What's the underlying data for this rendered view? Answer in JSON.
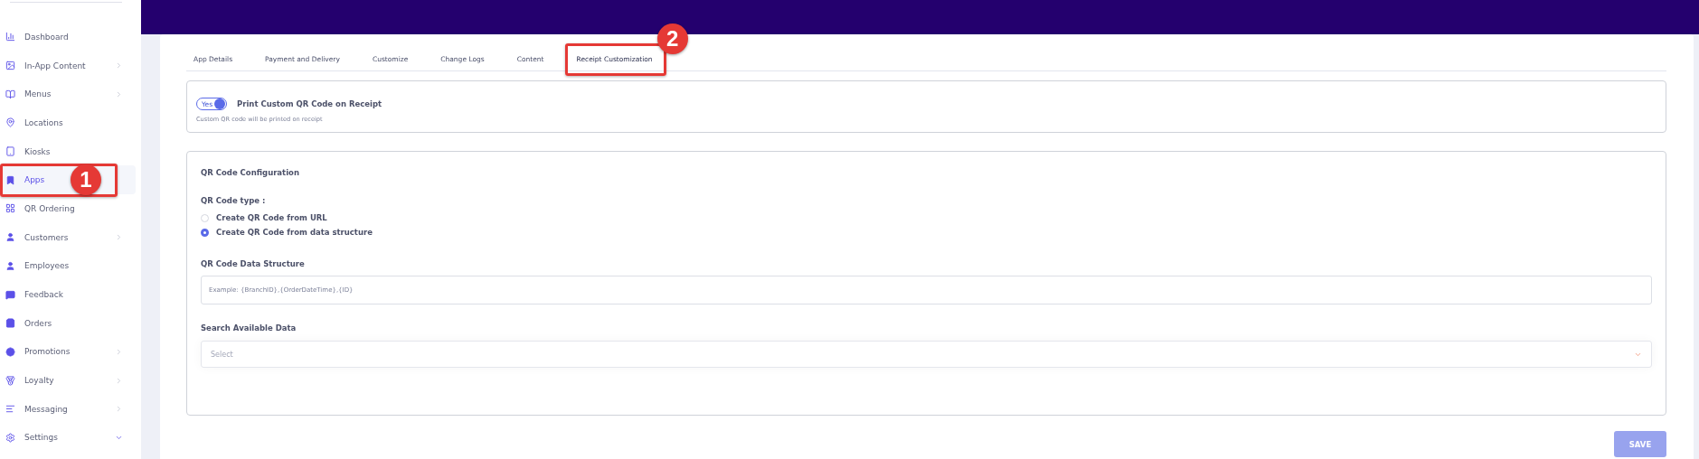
{
  "sidebar": {
    "items": [
      {
        "label": "Dashboard",
        "selected": false
      },
      {
        "label": "In-App Content",
        "selected": false,
        "expanded": false
      },
      {
        "label": "Menus",
        "selected": false,
        "expanded": false
      },
      {
        "label": "Locations",
        "selected": false
      },
      {
        "label": "Kiosks",
        "selected": false
      },
      {
        "label": "Apps",
        "selected": true,
        "annotation": "1"
      },
      {
        "label": "QR Ordering",
        "selected": false
      },
      {
        "label": "Customers",
        "selected": false,
        "expanded": false
      },
      {
        "label": "Employees",
        "selected": false
      },
      {
        "label": "Feedback",
        "selected": false
      },
      {
        "label": "Orders",
        "selected": false
      },
      {
        "label": "Promotions",
        "selected": false,
        "expanded": false
      },
      {
        "label": "Loyalty",
        "selected": false,
        "expanded": false
      },
      {
        "label": "Messaging",
        "selected": false,
        "expanded": false
      },
      {
        "label": "Settings",
        "selected": false,
        "expanded": true
      }
    ]
  },
  "tabs": [
    {
      "label": "App Details",
      "selected": false
    },
    {
      "label": "Payment and Delivery",
      "selected": false
    },
    {
      "label": "Customize",
      "selected": false
    },
    {
      "label": "Change Logs",
      "selected": false
    },
    {
      "label": "Content",
      "selected": false
    },
    {
      "label": "Receipt Customization",
      "selected": true,
      "annotation": "2"
    }
  ],
  "print_toggle": {
    "toggle_label": "Yes",
    "on": true,
    "title": "Print Custom QR Code on Receipt",
    "hint": "Custom QR code will be printed on receipt"
  },
  "qr_config": {
    "title": "QR Code Configuration",
    "type_label": "QR Code type :",
    "options": [
      {
        "label": "Create QR Code from URL",
        "selected": false
      },
      {
        "label": "Create QR Code from data structure",
        "selected": true
      }
    ],
    "structure_label": "QR Code Data Structure",
    "structure_placeholder": "Example: {BranchID},{OrderDateTime},{ID}",
    "search_label": "Search Available Data",
    "search_placeholder": "Select"
  },
  "save_button": "SAVE"
}
